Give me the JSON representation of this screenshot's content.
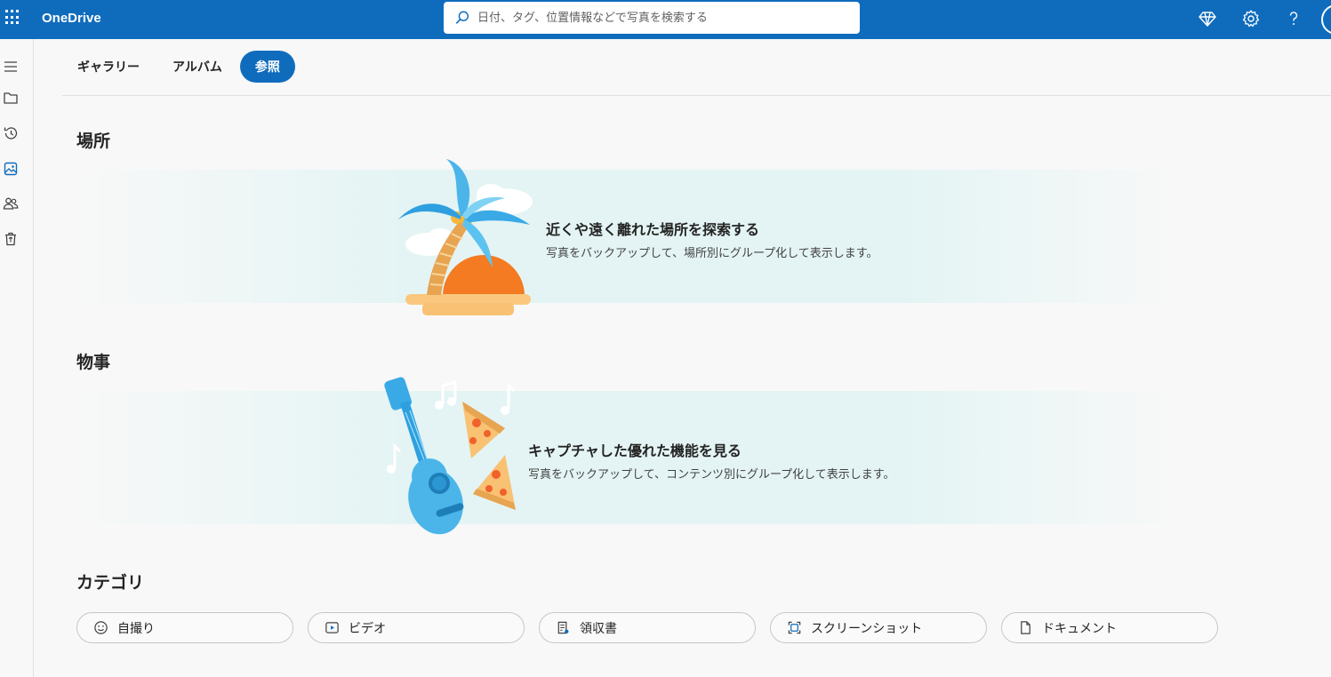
{
  "app": {
    "brand": "OneDrive"
  },
  "search": {
    "placeholder": "日付、タグ、位置情報などで写真を検索する"
  },
  "tabs": [
    {
      "label": "ギャラリー",
      "active": false
    },
    {
      "label": "アルバム",
      "active": false
    },
    {
      "label": "参照",
      "active": true
    }
  ],
  "sections": {
    "places": {
      "title": "場所",
      "banner_title": "近くや遠く離れた場所を探索する",
      "banner_sub": "写真をバックアップして、場所別にグループ化して表示します。"
    },
    "things": {
      "title": "物事",
      "banner_title": "キャプチャした優れた機能を見る",
      "banner_sub": "写真をバックアップして、コンテンツ別にグループ化して表示します。"
    },
    "categories": {
      "title": "カテゴリ",
      "items": [
        {
          "label": "自撮り",
          "icon": "smile-icon"
        },
        {
          "label": "ビデオ",
          "icon": "video-icon"
        },
        {
          "label": "領収書",
          "icon": "receipt-icon"
        },
        {
          "label": "スクリーンショット",
          "icon": "screenshot-icon"
        },
        {
          "label": "ドキュメント",
          "icon": "document-icon"
        }
      ]
    }
  },
  "colors": {
    "accent": "#0f6cbd",
    "banner": "#e4f4f4"
  }
}
